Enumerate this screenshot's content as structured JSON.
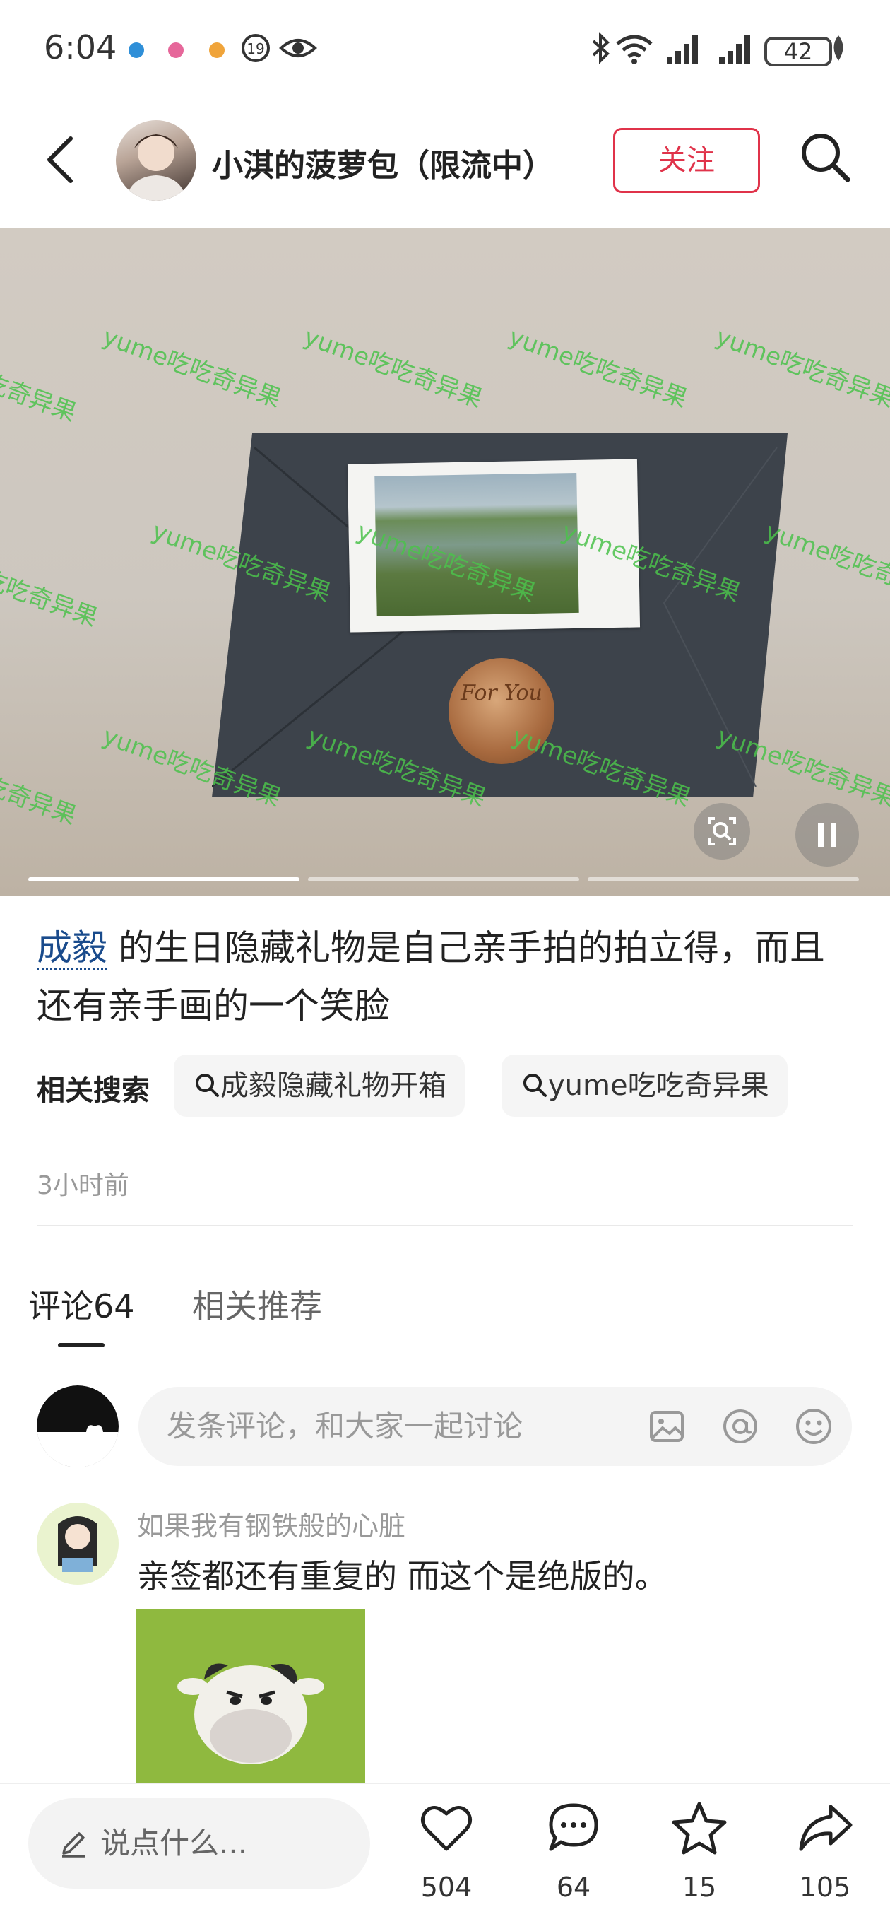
{
  "status_bar": {
    "time": "6:04",
    "battery": "42"
  },
  "header": {
    "username": "小淇的菠萝包（限流中）",
    "follow_label": "关注"
  },
  "media": {
    "watermark": "yume吃吃奇异果",
    "seal_text": "For You"
  },
  "post": {
    "caption_link": "成毅",
    "caption_rest": " 的生日隐藏礼物是自己亲手拍的拍立得，而且还有亲手画的一个笑脸",
    "related_label": "相关搜索",
    "related": [
      "成毅隐藏礼物开箱",
      "yume吃吃奇异果"
    ],
    "time": "3小时前"
  },
  "tabs": {
    "comments": "评论64",
    "recommend": "相关推荐"
  },
  "comment_input": {
    "placeholder": "发条评论，和大家一起讨论"
  },
  "comments": [
    {
      "user": "如果我有钢铁般的心脏",
      "text": "亲签都还有重复的 而这个是绝版的。"
    }
  ],
  "bottom_bar": {
    "say_placeholder": "说点什么...",
    "likes": "504",
    "comments": "64",
    "stars": "15",
    "shares": "105"
  },
  "colors": {
    "accent": "#e0334a",
    "link": "#1a4b8c",
    "watermark": "#4cc24c"
  }
}
